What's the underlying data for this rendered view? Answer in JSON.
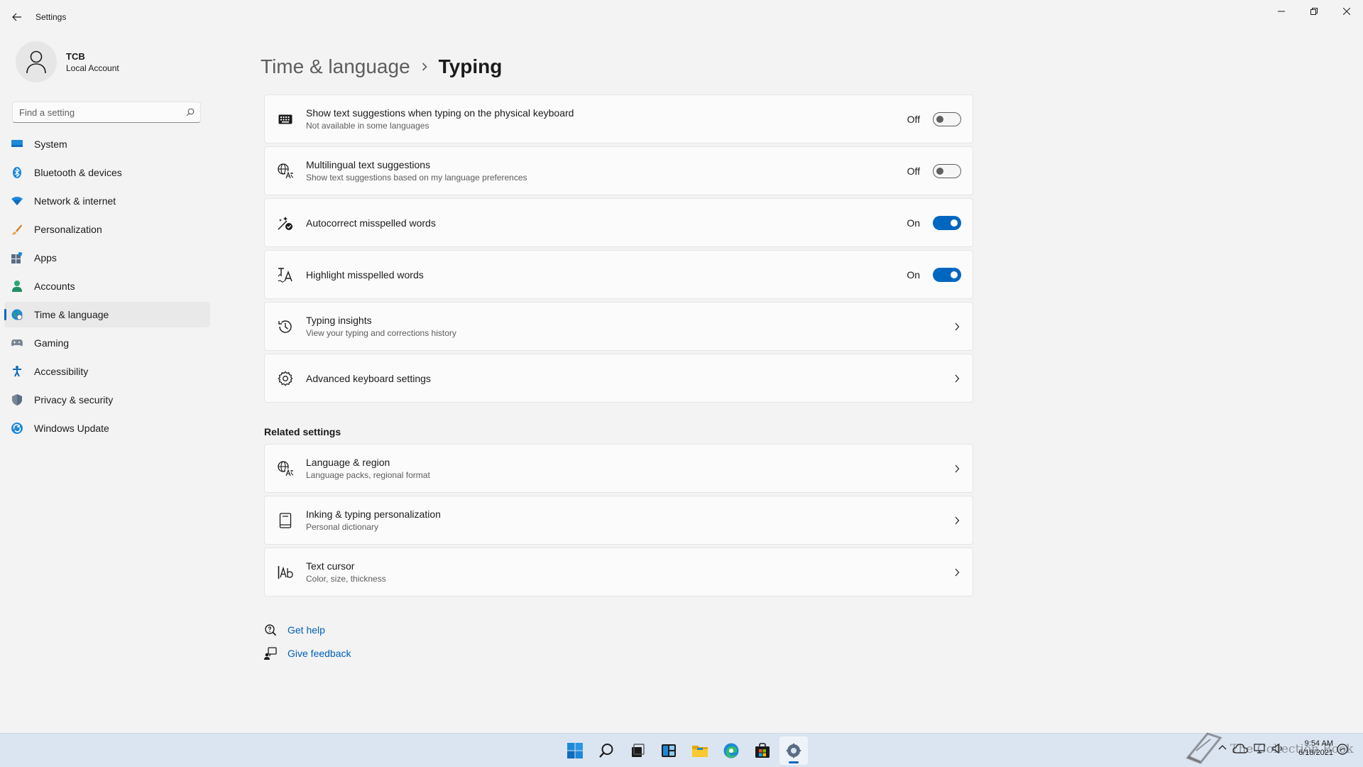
{
  "window": {
    "title": "Settings"
  },
  "user": {
    "name": "TCB",
    "account_type": "Local Account"
  },
  "search": {
    "placeholder": "Find a setting"
  },
  "sidebar": {
    "items": [
      {
        "label": "System",
        "icon": "system-icon"
      },
      {
        "label": "Bluetooth & devices",
        "icon": "bluetooth-icon"
      },
      {
        "label": "Network & internet",
        "icon": "wifi-icon"
      },
      {
        "label": "Personalization",
        "icon": "brush-icon"
      },
      {
        "label": "Apps",
        "icon": "apps-icon"
      },
      {
        "label": "Accounts",
        "icon": "person-icon"
      },
      {
        "label": "Time & language",
        "icon": "globe-clock-icon",
        "active": true
      },
      {
        "label": "Gaming",
        "icon": "gamepad-icon"
      },
      {
        "label": "Accessibility",
        "icon": "accessibility-icon"
      },
      {
        "label": "Privacy & security",
        "icon": "shield-icon"
      },
      {
        "label": "Windows Update",
        "icon": "update-icon"
      }
    ]
  },
  "breadcrumb": {
    "parent": "Time & language",
    "current": "Typing"
  },
  "settings": [
    {
      "title": "Show text suggestions when typing on the physical keyboard",
      "subtitle": "Not available in some languages",
      "control": "toggle",
      "state": "Off",
      "icon": "keyboard-icon"
    },
    {
      "title": "Multilingual text suggestions",
      "subtitle": "Show text suggestions based on my language preferences",
      "control": "toggle",
      "state": "Off",
      "icon": "language-icon"
    },
    {
      "title": "Autocorrect misspelled words",
      "subtitle": "",
      "control": "toggle",
      "state": "On",
      "icon": "autocorrect-icon"
    },
    {
      "title": "Highlight misspelled words",
      "subtitle": "",
      "control": "toggle",
      "state": "On",
      "icon": "spellcheck-icon"
    },
    {
      "title": "Typing insights",
      "subtitle": "View your typing and corrections history",
      "control": "chevron",
      "icon": "history-icon"
    },
    {
      "title": "Advanced keyboard settings",
      "subtitle": "",
      "control": "chevron",
      "icon": "gear-icon"
    }
  ],
  "related": {
    "heading": "Related settings",
    "items": [
      {
        "title": "Language & region",
        "subtitle": "Language packs, regional format",
        "icon": "language-icon"
      },
      {
        "title": "Inking & typing personalization",
        "subtitle": "Personal dictionary",
        "icon": "dictionary-icon"
      },
      {
        "title": "Text cursor",
        "subtitle": "Color, size, thickness",
        "icon": "text-cursor-icon"
      }
    ]
  },
  "help": {
    "get_help": "Get help",
    "give_feedback": "Give feedback"
  },
  "taskbar": {
    "apps": [
      "start-icon",
      "search-icon",
      "task-view-icon",
      "widgets-icon",
      "file-explorer-icon",
      "edge-icon",
      "store-icon",
      "settings-icon"
    ],
    "active_app": "settings-icon"
  },
  "tray": {
    "watermark": "The Collection Book",
    "time": "9:54 AM",
    "date": "6/18/2021"
  },
  "colors": {
    "accent": "#0067c0",
    "link": "#005fb8",
    "background": "#f3f3f3",
    "card": "#fbfbfb",
    "taskbar": "#dbe5f1"
  }
}
